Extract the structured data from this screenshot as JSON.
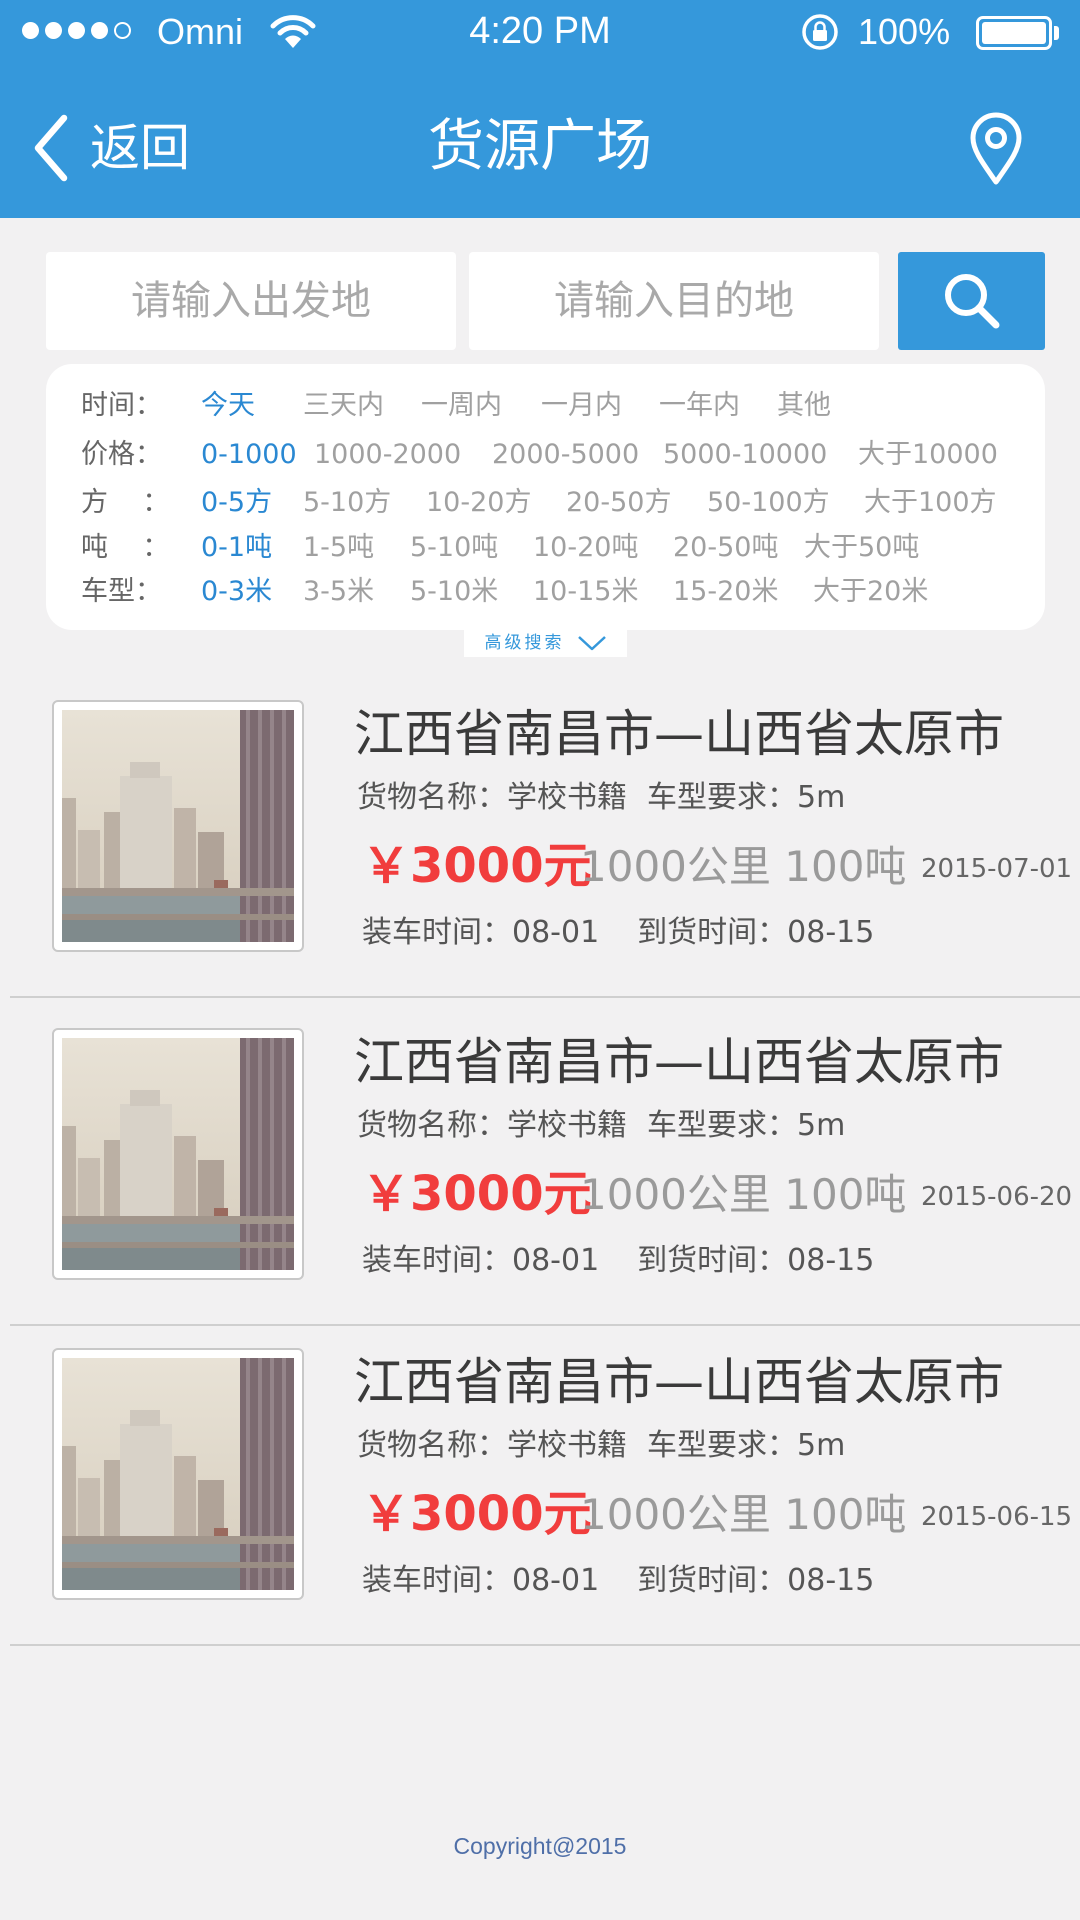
{
  "status_bar": {
    "carrier": "Omni",
    "time": "4:20 PM",
    "battery": "100%",
    "signal_bars": 4
  },
  "nav": {
    "back_label": "返回",
    "title": "货源广场",
    "location_icon": "map-pin-icon"
  },
  "search": {
    "from_placeholder": "请输入出发地",
    "to_placeholder": "请输入目的地",
    "button_icon": "search-icon"
  },
  "filters": {
    "time": {
      "label": "时间：",
      "options": [
        "今天",
        "三天内",
        "一周内",
        "一月内",
        "一年内",
        "其他"
      ],
      "selected": "今天"
    },
    "price": {
      "label": "价格：",
      "options": [
        "0-1000",
        "1000-2000",
        "2000-5000",
        "5000-10000",
        "大于10000"
      ],
      "selected": "0-1000"
    },
    "volume": {
      "label": "方    ：",
      "options": [
        "0-5方",
        "5-10方",
        "10-20方",
        "20-50方",
        "50-100方",
        "大于100方"
      ],
      "selected": "0-5方"
    },
    "weight": {
      "label": "吨    ：",
      "options": [
        "0-1吨",
        "1-5吨",
        "5-10吨",
        "10-20吨",
        "20-50吨",
        "大于50吨"
      ],
      "selected": "0-1吨"
    },
    "vehicle": {
      "label": "车型：",
      "options": [
        "0-3米",
        "3-5米",
        "5-10米",
        "10-15米",
        "15-20米",
        "大于20米"
      ],
      "selected": "0-3米"
    },
    "advanced_label": "高级搜索"
  },
  "listings": [
    {
      "route": "江西省南昌市—山西省太原市",
      "cargo": "货物名称：学校书籍",
      "vehicle": "车型要求：5m",
      "price": "￥3000元",
      "distance": "1000公里",
      "weight": "100吨",
      "date": "2015-07-01",
      "load_time": "装车时间：08-01",
      "arrive_time": "到货时间：08-15"
    },
    {
      "route": "江西省南昌市—山西省太原市",
      "cargo": "货物名称：学校书籍",
      "vehicle": "车型要求：5m",
      "price": "￥3000元",
      "distance": "1000公里",
      "weight": "100吨",
      "date": "2015-06-20",
      "load_time": "装车时间：08-01",
      "arrive_time": "到货时间：08-15"
    },
    {
      "route": "江西省南昌市—山西省太原市",
      "cargo": "货物名称：学校书籍",
      "vehicle": "车型要求：5m",
      "price": "￥3000元",
      "distance": "1000公里",
      "weight": "100吨",
      "date": "2015-06-15",
      "load_time": "装车时间：08-01",
      "arrive_time": "到货时间：08-15"
    }
  ],
  "footer": {
    "copyright": "Copyright@2015"
  },
  "colors": {
    "brand_blue": "#3598db",
    "active_filter": "#2a88d2",
    "price_red": "#f13d3d",
    "background": "#f2f1f2"
  }
}
